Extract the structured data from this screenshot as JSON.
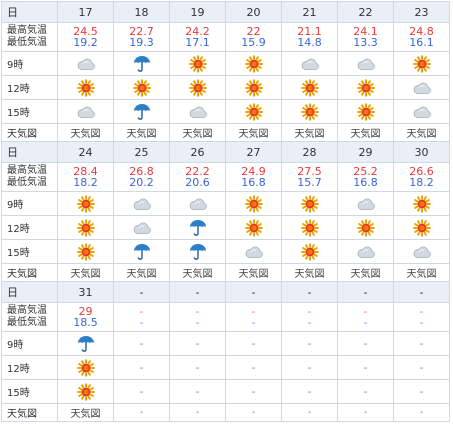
{
  "labels": {
    "day": "日",
    "max_temp": "最高気温",
    "min_temp": "最低気温",
    "h9": "9時",
    "h12": "12時",
    "h15": "15時",
    "map": "天気図"
  },
  "dash": "-",
  "colors": {
    "max": "#e83a3a",
    "min": "#3a64d8",
    "header_bg": "#e8eff7",
    "border": "#cfd9e6"
  },
  "icon_names": {
    "sun": "sun-icon",
    "cloud": "cloud-icon",
    "rain": "umbrella-icon"
  },
  "weeks": [
    {
      "days": [
        {
          "day": "17",
          "max": "24.5",
          "min": "19.2",
          "h9": "cloud",
          "h12": "sun",
          "h15": "cloud",
          "map": "天気図"
        },
        {
          "day": "18",
          "max": "22.7",
          "min": "19.3",
          "h9": "rain",
          "h12": "sun",
          "h15": "rain",
          "map": "天気図"
        },
        {
          "day": "19",
          "max": "24.2",
          "min": "17.1",
          "h9": "sun",
          "h12": "sun",
          "h15": "cloud",
          "map": "天気図"
        },
        {
          "day": "20",
          "max": "22",
          "min": "15.9",
          "h9": "sun",
          "h12": "sun",
          "h15": "sun",
          "map": "天気図"
        },
        {
          "day": "21",
          "max": "21.1",
          "min": "14.8",
          "h9": "cloud",
          "h12": "sun",
          "h15": "sun",
          "map": "天気図"
        },
        {
          "day": "22",
          "max": "24.1",
          "min": "13.3",
          "h9": "cloud",
          "h12": "sun",
          "h15": "sun",
          "map": "天気図"
        },
        {
          "day": "23",
          "max": "24.8",
          "min": "16.1",
          "h9": "sun",
          "h12": "cloud",
          "h15": "cloud",
          "map": "天気図"
        }
      ]
    },
    {
      "days": [
        {
          "day": "24",
          "max": "28.4",
          "min": "18.2",
          "h9": "sun",
          "h12": "sun",
          "h15": "sun",
          "map": "天気図"
        },
        {
          "day": "25",
          "max": "26.8",
          "min": "20.2",
          "h9": "cloud",
          "h12": "cloud",
          "h15": "rain",
          "map": "天気図"
        },
        {
          "day": "26",
          "max": "22.2",
          "min": "20.6",
          "h9": "cloud",
          "h12": "rain",
          "h15": "rain",
          "map": "天気図"
        },
        {
          "day": "27",
          "max": "24.9",
          "min": "16.8",
          "h9": "sun",
          "h12": "sun",
          "h15": "cloud",
          "map": "天気図"
        },
        {
          "day": "28",
          "max": "27.5",
          "min": "15.7",
          "h9": "sun",
          "h12": "sun",
          "h15": "sun",
          "map": "天気図"
        },
        {
          "day": "29",
          "max": "25.2",
          "min": "16.8",
          "h9": "cloud",
          "h12": "sun",
          "h15": "cloud",
          "map": "天気図"
        },
        {
          "day": "30",
          "max": "26.6",
          "min": "18.2",
          "h9": "sun",
          "h12": "sun",
          "h15": "cloud",
          "map": "天気図"
        }
      ]
    },
    {
      "days": [
        {
          "day": "31",
          "max": "29",
          "min": "18.5",
          "h9": "rain",
          "h12": "sun",
          "h15": "sun",
          "map": "天気図"
        },
        {
          "day": "-",
          "max": "-",
          "min": "-",
          "h9": "-",
          "h12": "-",
          "h15": "-",
          "map": "-"
        },
        {
          "day": "-",
          "max": "-",
          "min": "-",
          "h9": "-",
          "h12": "-",
          "h15": "-",
          "map": "-"
        },
        {
          "day": "-",
          "max": "-",
          "min": "-",
          "h9": "-",
          "h12": "-",
          "h15": "-",
          "map": "-"
        },
        {
          "day": "-",
          "max": "-",
          "min": "-",
          "h9": "-",
          "h12": "-",
          "h15": "-",
          "map": "-"
        },
        {
          "day": "-",
          "max": "-",
          "min": "-",
          "h9": "-",
          "h12": "-",
          "h15": "-",
          "map": "-"
        },
        {
          "day": "-",
          "max": "-",
          "min": "-",
          "h9": "-",
          "h12": "-",
          "h15": "-",
          "map": "-"
        }
      ]
    }
  ]
}
